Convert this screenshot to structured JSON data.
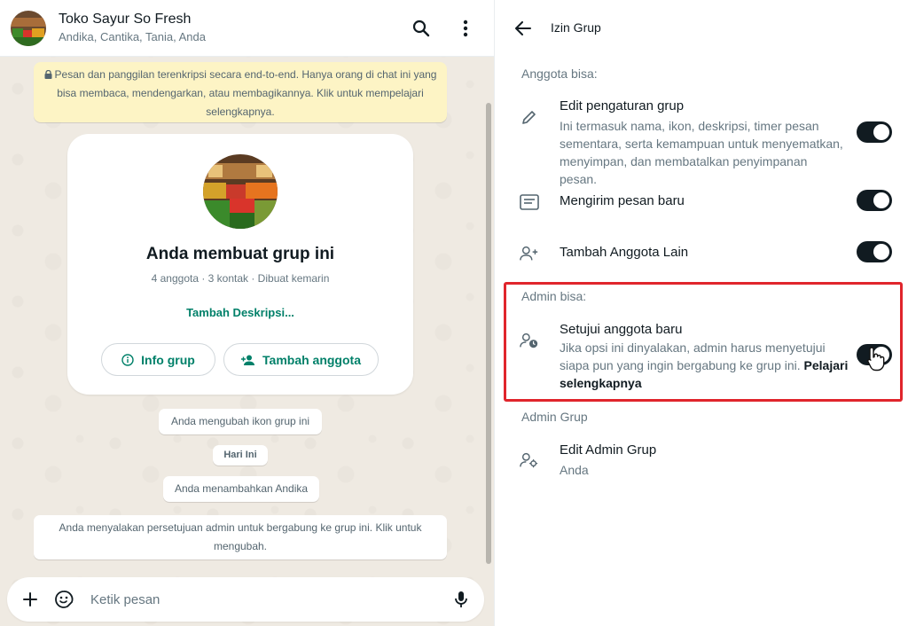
{
  "chat": {
    "title": "Toko Sayur So Fresh",
    "members": "Andika, Cantika, Tania, Anda",
    "encryption_notice": "Pesan dan panggilan terenkripsi secara end-to-end. Hanya orang di chat ini yang bisa membaca, mendengarkan, atau membagikannya. Klik untuk mempelajari selengkapnya.",
    "card": {
      "heading": "Anda membuat grup ini",
      "meta": "4 anggota · 3 kontak · Dibuat kemarin",
      "add_description": "Tambah Deskripsi...",
      "info_button": "Info grup",
      "add_member_button": "Tambah anggota"
    },
    "system_messages": [
      "Anda mengubah ikon grup ini",
      "Hari Ini",
      "Anda menambahkan Andika",
      "Anda menyalakan persetujuan admin untuk bergabung ke grup ini. Klik untuk mengubah."
    ],
    "composer_placeholder": "Ketik pesan"
  },
  "permissions": {
    "title": "Izin Grup",
    "members_section": "Anggota bisa:",
    "items": [
      {
        "icon": "pencil-icon",
        "title": "Edit pengaturan grup",
        "desc": "Ini termasuk nama, ikon, deskripsi, timer pesan sementara, serta kemampuan untuk menyematkan, menyimpan, dan membatalkan penyimpanan pesan.",
        "enabled": true
      },
      {
        "icon": "message-icon",
        "title": "Mengirim pesan baru",
        "enabled": true
      },
      {
        "icon": "add-member-icon",
        "title": "Tambah Anggota Lain",
        "enabled": true
      }
    ],
    "admin_section": "Admin bisa:",
    "admin_items": [
      {
        "icon": "approve-member-icon",
        "title": "Setujui anggota baru",
        "desc": "Jika opsi ini dinyalakan, admin harus menyetujui siapa pun yang ingin bergabung ke grup ini.",
        "desc_link": "Pelajari selengkapnya",
        "enabled": true
      }
    ],
    "group_admin_section": "Admin Grup",
    "edit_admin": {
      "icon": "admin-settings-icon",
      "title": "Edit Admin Grup",
      "value": "Anda"
    }
  },
  "colors": {
    "accent": "#008069",
    "toggle_on": "#111b21",
    "highlight": "#e0252c",
    "notice_bg": "#fdf4c5"
  }
}
